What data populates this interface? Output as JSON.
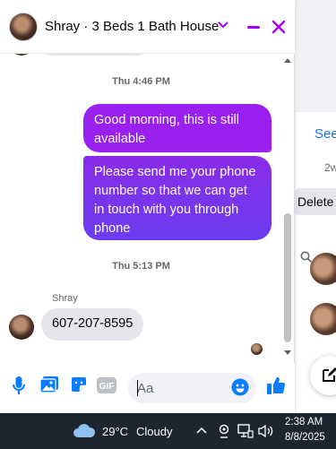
{
  "header": {
    "contact_name": "Shray",
    "separator": " · ",
    "listing_title": "3 Beds 1 Bath House"
  },
  "background": {
    "see_link": "See",
    "time_label": "2w",
    "delete_label": "Delete"
  },
  "messages": {
    "time_1": "Thu 4:46 PM",
    "outgoing_1": "Good morning, this is still available",
    "outgoing_2": "Please send me your phone number so that we can get in touch with you through phone",
    "time_2": "Thu 5:13 PM",
    "incoming_sender": "Shray",
    "incoming_1": "607-207-8595"
  },
  "composer": {
    "placeholder": "Aa"
  },
  "taskbar": {
    "temperature": "29°C",
    "condition": "Cloudy",
    "time": "2:38 AM",
    "date": "8/8/2025"
  },
  "colors": {
    "accent": "#a100ff",
    "outgoing_bubble_top": "#9a20f0",
    "outgoing_bubble_bottom": "#6b3df0",
    "incoming_bubble": "#e4e6eb",
    "messenger_blue": "#0a7cff",
    "taskbar": "#1c2530"
  }
}
